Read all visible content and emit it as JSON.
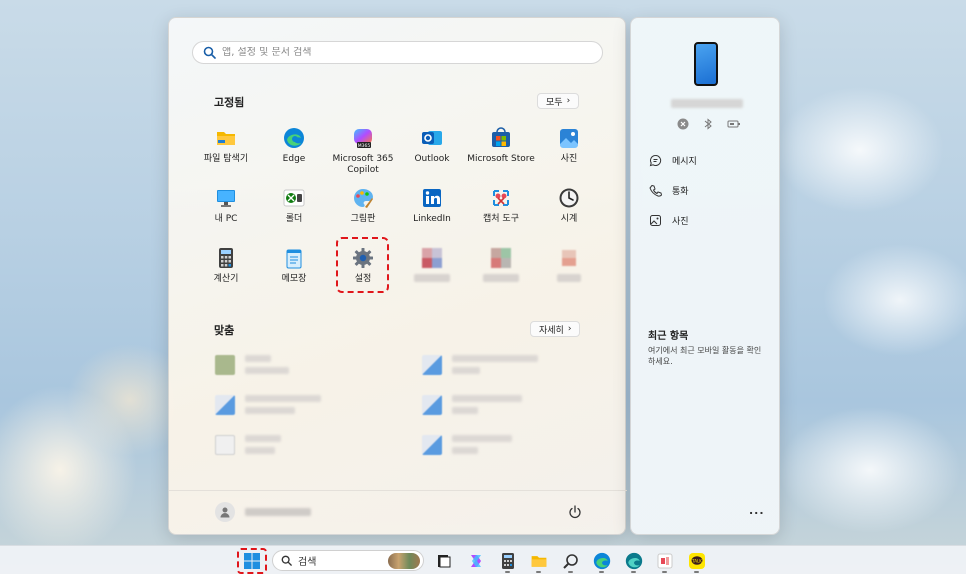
{
  "search": {
    "placeholder": "앱, 설정 및 문서 검색"
  },
  "pinned": {
    "title": "고정됨",
    "all_button": "모두",
    "apps": [
      {
        "label": "파일 탐색기",
        "icon": "folder-icon"
      },
      {
        "label": "Edge",
        "icon": "edge-icon"
      },
      {
        "label": "Microsoft 365\nCopilot",
        "icon": "m365-copilot-icon"
      },
      {
        "label": "Outlook",
        "icon": "outlook-icon"
      },
      {
        "label": "Microsoft Store",
        "icon": "store-icon"
      },
      {
        "label": "사진",
        "icon": "photos-icon"
      },
      {
        "label": "내 PC",
        "icon": "monitor-icon"
      },
      {
        "label": "롤더",
        "icon": "xbox-icon"
      },
      {
        "label": "그림판",
        "icon": "paint-icon"
      },
      {
        "label": "LinkedIn",
        "icon": "linkedin-icon"
      },
      {
        "label": "캡처 도구",
        "icon": "snipping-tool-icon"
      },
      {
        "label": "시계",
        "icon": "clock-icon"
      },
      {
        "label": "계산기",
        "icon": "calculator-icon"
      },
      {
        "label": "메모장",
        "icon": "notepad-icon"
      },
      {
        "label": "설정",
        "icon": "gear-icon"
      }
    ]
  },
  "recommended": {
    "title": "맞춤",
    "more_button": "자세히"
  },
  "side_panel": {
    "items": [
      {
        "label": "메시지",
        "icon": "message-icon"
      },
      {
        "label": "통화",
        "icon": "phone-call-icon"
      },
      {
        "label": "사진",
        "icon": "photo-icon"
      }
    ],
    "recent_title": "최근 항목",
    "recent_desc": "여기에서 최근 모바일 활동을 확인하세요.",
    "more": "..."
  },
  "taskbar": {
    "search_label": "검색"
  },
  "colors": {
    "highlight": "#e0161b",
    "accent": "#0f6cbd"
  }
}
